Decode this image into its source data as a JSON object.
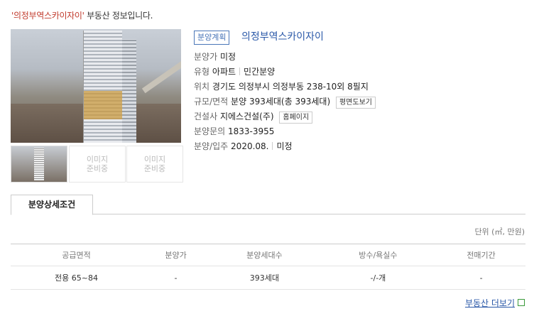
{
  "header": {
    "quoted_name": "'의정부역스카이자이'",
    "suffix": " 부동산 정보입니다."
  },
  "thumbs": {
    "placeholder_line1": "이미지",
    "placeholder_line2": "준비중"
  },
  "badge": "분양계획",
  "title": "의정부역스카이자이",
  "rows": {
    "price": {
      "label": "분양가",
      "value": "미정"
    },
    "type": {
      "label": "유형",
      "value1": "아파트",
      "value2": "민간분양"
    },
    "location": {
      "label": "위치",
      "value": "경기도 의정부시 의정부동 238-10외 8필지"
    },
    "size": {
      "label": "규모/면적",
      "value": "분양 393세대(총 393세대)",
      "button": "평면도보기"
    },
    "builder": {
      "label": "건설사",
      "value": "지에스건설(주)",
      "button": "홈페이지"
    },
    "contact": {
      "label": "분양문의",
      "value": "1833-3955"
    },
    "schedule": {
      "label": "분양/입주",
      "value1": "2020.08.",
      "value2": "미정"
    }
  },
  "tab": {
    "label": "분양상세조건"
  },
  "unit": "단위 (㎡, 만원)",
  "table": {
    "headers": [
      "공급면적",
      "분양가",
      "분양세대수",
      "방수/욕실수",
      "전매기간"
    ],
    "rows": [
      [
        "전용 65~84",
        "-",
        "393세대",
        "-/-개",
        "-"
      ]
    ]
  },
  "more_link": "부동산 더보기"
}
